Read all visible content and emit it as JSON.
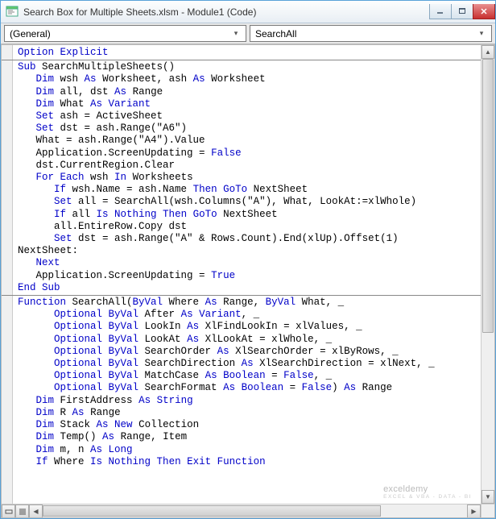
{
  "title": "Search Box for Multiple Sheets.xlsm - Module1 (Code)",
  "dropdowns": {
    "object": "(General)",
    "procedure": "SearchAll"
  },
  "watermark": {
    "line1": "exceldemy",
    "line2": "EXCEL & VBA - DATA - BI"
  },
  "code": [
    {
      "indent": 0,
      "t": [
        [
          "kw",
          "Option Explicit"
        ]
      ]
    },
    {
      "hr": true
    },
    {
      "indent": 0,
      "t": [
        [
          "kw",
          "Sub"
        ],
        [
          "",
          " SearchMultipleSheets()"
        ]
      ]
    },
    {
      "indent": 1,
      "t": [
        [
          "kw",
          "Dim"
        ],
        [
          "",
          " wsh "
        ],
        [
          "kw",
          "As"
        ],
        [
          "",
          " Worksheet, ash "
        ],
        [
          "kw",
          "As"
        ],
        [
          "",
          " Worksheet"
        ]
      ]
    },
    {
      "indent": 1,
      "t": [
        [
          "kw",
          "Dim"
        ],
        [
          "",
          " all, dst "
        ],
        [
          "kw",
          "As"
        ],
        [
          "",
          " Range"
        ]
      ]
    },
    {
      "indent": 1,
      "t": [
        [
          "kw",
          "Dim"
        ],
        [
          "",
          " What "
        ],
        [
          "kw",
          "As Variant"
        ]
      ]
    },
    {
      "indent": 1,
      "t": [
        [
          "kw",
          "Set"
        ],
        [
          "",
          " ash = ActiveSheet"
        ]
      ]
    },
    {
      "indent": 1,
      "t": [
        [
          "kw",
          "Set"
        ],
        [
          "",
          " dst = ash.Range(\"A6\")"
        ]
      ]
    },
    {
      "indent": 1,
      "t": [
        [
          "",
          "What = ash.Range(\"A4\").Value"
        ]
      ]
    },
    {
      "indent": 1,
      "t": [
        [
          "",
          "Application.ScreenUpdating = "
        ],
        [
          "kw",
          "False"
        ]
      ]
    },
    {
      "indent": 1,
      "t": [
        [
          "",
          "dst.CurrentRegion.Clear"
        ]
      ]
    },
    {
      "indent": 1,
      "t": [
        [
          "kw",
          "For Each"
        ],
        [
          "",
          " wsh "
        ],
        [
          "kw",
          "In"
        ],
        [
          "",
          " Worksheets"
        ]
      ]
    },
    {
      "indent": 2,
      "t": [
        [
          "kw",
          "If"
        ],
        [
          "",
          " wsh.Name = ash.Name "
        ],
        [
          "kw",
          "Then GoTo"
        ],
        [
          "",
          " NextSheet"
        ]
      ]
    },
    {
      "indent": 2,
      "t": [
        [
          "kw",
          "Set"
        ],
        [
          "",
          " all = SearchAll(wsh.Columns(\"A\"), What, LookAt:=xlWhole)"
        ]
      ]
    },
    {
      "indent": 2,
      "t": [
        [
          "kw",
          "If"
        ],
        [
          "",
          " all "
        ],
        [
          "kw",
          "Is Nothing Then GoTo"
        ],
        [
          "",
          " NextSheet"
        ]
      ]
    },
    {
      "indent": 2,
      "t": [
        [
          "",
          "all.EntireRow.Copy dst"
        ]
      ]
    },
    {
      "indent": 2,
      "t": [
        [
          "kw",
          "Set"
        ],
        [
          "",
          " dst = ash.Range(\"A\" & Rows.Count).End(xlUp).Offset(1)"
        ]
      ]
    },
    {
      "indent": 0,
      "t": [
        [
          "",
          "NextSheet:"
        ]
      ]
    },
    {
      "indent": 1,
      "t": [
        [
          "kw",
          "Next"
        ]
      ]
    },
    {
      "indent": 1,
      "t": [
        [
          "",
          "Application.ScreenUpdating = "
        ],
        [
          "kw",
          "True"
        ]
      ]
    },
    {
      "indent": 0,
      "t": [
        [
          "kw",
          "End Sub"
        ]
      ]
    },
    {
      "hr": true
    },
    {
      "indent": 0,
      "t": [
        [
          "kw",
          "Function"
        ],
        [
          "",
          " SearchAll("
        ],
        [
          "kw",
          "ByVal"
        ],
        [
          "",
          " Where "
        ],
        [
          "kw",
          "As"
        ],
        [
          "",
          " Range, "
        ],
        [
          "kw",
          "ByVal"
        ],
        [
          "",
          " What, _"
        ]
      ]
    },
    {
      "indent": 2,
      "t": [
        [
          "kw",
          "Optional ByVal"
        ],
        [
          "",
          " After "
        ],
        [
          "kw",
          "As Variant"
        ],
        [
          "",
          ", _"
        ]
      ]
    },
    {
      "indent": 2,
      "t": [
        [
          "kw",
          "Optional ByVal"
        ],
        [
          "",
          " LookIn "
        ],
        [
          "kw",
          "As"
        ],
        [
          "",
          " XlFindLookIn = xlValues, _"
        ]
      ]
    },
    {
      "indent": 2,
      "t": [
        [
          "kw",
          "Optional ByVal"
        ],
        [
          "",
          " LookAt "
        ],
        [
          "kw",
          "As"
        ],
        [
          "",
          " XlLookAt = xlWhole, _"
        ]
      ]
    },
    {
      "indent": 2,
      "t": [
        [
          "kw",
          "Optional ByVal"
        ],
        [
          "",
          " SearchOrder "
        ],
        [
          "kw",
          "As"
        ],
        [
          "",
          " XlSearchOrder = xlByRows, _"
        ]
      ]
    },
    {
      "indent": 2,
      "t": [
        [
          "kw",
          "Optional ByVal"
        ],
        [
          "",
          " SearchDirection "
        ],
        [
          "kw",
          "As"
        ],
        [
          "",
          " XlSearchDirection = xlNext, _"
        ]
      ]
    },
    {
      "indent": 2,
      "t": [
        [
          "kw",
          "Optional ByVal"
        ],
        [
          "",
          " MatchCase "
        ],
        [
          "kw",
          "As Boolean"
        ],
        [
          "",
          " = "
        ],
        [
          "kw",
          "False"
        ],
        [
          "",
          ", _"
        ]
      ]
    },
    {
      "indent": 2,
      "t": [
        [
          "kw",
          "Optional ByVal"
        ],
        [
          "",
          " SearchFormat "
        ],
        [
          "kw",
          "As Boolean"
        ],
        [
          "",
          " = "
        ],
        [
          "kw",
          "False"
        ],
        [
          "",
          ") "
        ],
        [
          "kw",
          "As"
        ],
        [
          "",
          " Range"
        ]
      ]
    },
    {
      "indent": 1,
      "t": [
        [
          "kw",
          "Dim"
        ],
        [
          "",
          " FirstAddress "
        ],
        [
          "kw",
          "As String"
        ]
      ]
    },
    {
      "indent": 1,
      "t": [
        [
          "kw",
          "Dim"
        ],
        [
          "",
          " R "
        ],
        [
          "kw",
          "As"
        ],
        [
          "",
          " Range"
        ]
      ]
    },
    {
      "indent": 1,
      "t": [
        [
          "kw",
          "Dim"
        ],
        [
          "",
          " Stack "
        ],
        [
          "kw",
          "As New"
        ],
        [
          "",
          " Collection"
        ]
      ]
    },
    {
      "indent": 1,
      "t": [
        [
          "kw",
          "Dim"
        ],
        [
          "",
          " Temp() "
        ],
        [
          "kw",
          "As"
        ],
        [
          "",
          " Range, Item"
        ]
      ]
    },
    {
      "indent": 1,
      "t": [
        [
          "kw",
          "Dim"
        ],
        [
          "",
          " m, n "
        ],
        [
          "kw",
          "As Long"
        ]
      ]
    },
    {
      "indent": 1,
      "t": [
        [
          "kw",
          "If"
        ],
        [
          "",
          " Where "
        ],
        [
          "kw",
          "Is Nothing Then Exit Function"
        ]
      ]
    }
  ]
}
